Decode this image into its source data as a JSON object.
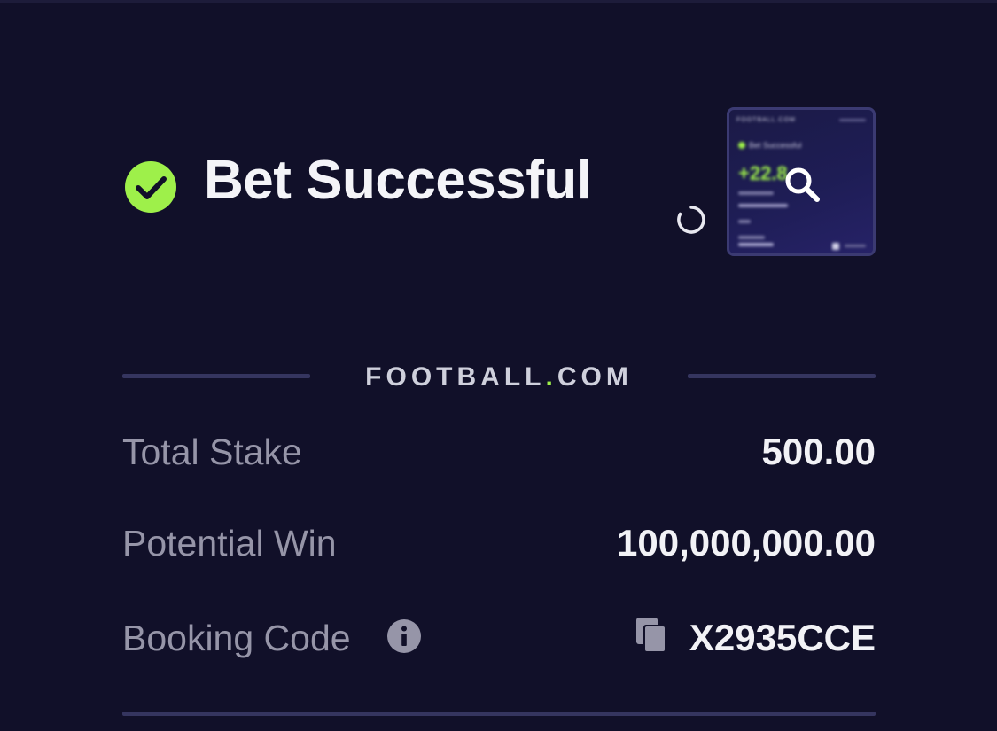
{
  "header": {
    "title": "Bet Successful",
    "status_icon": "check-circle-icon",
    "status_color": "#9ef04a"
  },
  "thumbnail": {
    "brand": "FOOTBALL.COM",
    "status_text": "Bet Successful",
    "amount_text": "+22.8",
    "zoom_icon": "search-icon"
  },
  "brand": {
    "left": "FOOTBALL",
    "dot": ".",
    "right": "COM"
  },
  "details": {
    "total_stake": {
      "label": "Total Stake",
      "value": "500.00"
    },
    "potential_win": {
      "label": "Potential Win",
      "value": "100,000,000.00"
    },
    "booking_code": {
      "label": "Booking Code",
      "value": "X2935CCE",
      "info_icon": "info-icon",
      "copy_icon": "copy-icon"
    }
  },
  "colors": {
    "background": "#111029",
    "accent": "#9ef04a",
    "divider": "#35355f",
    "muted_text": "#9695a8"
  }
}
